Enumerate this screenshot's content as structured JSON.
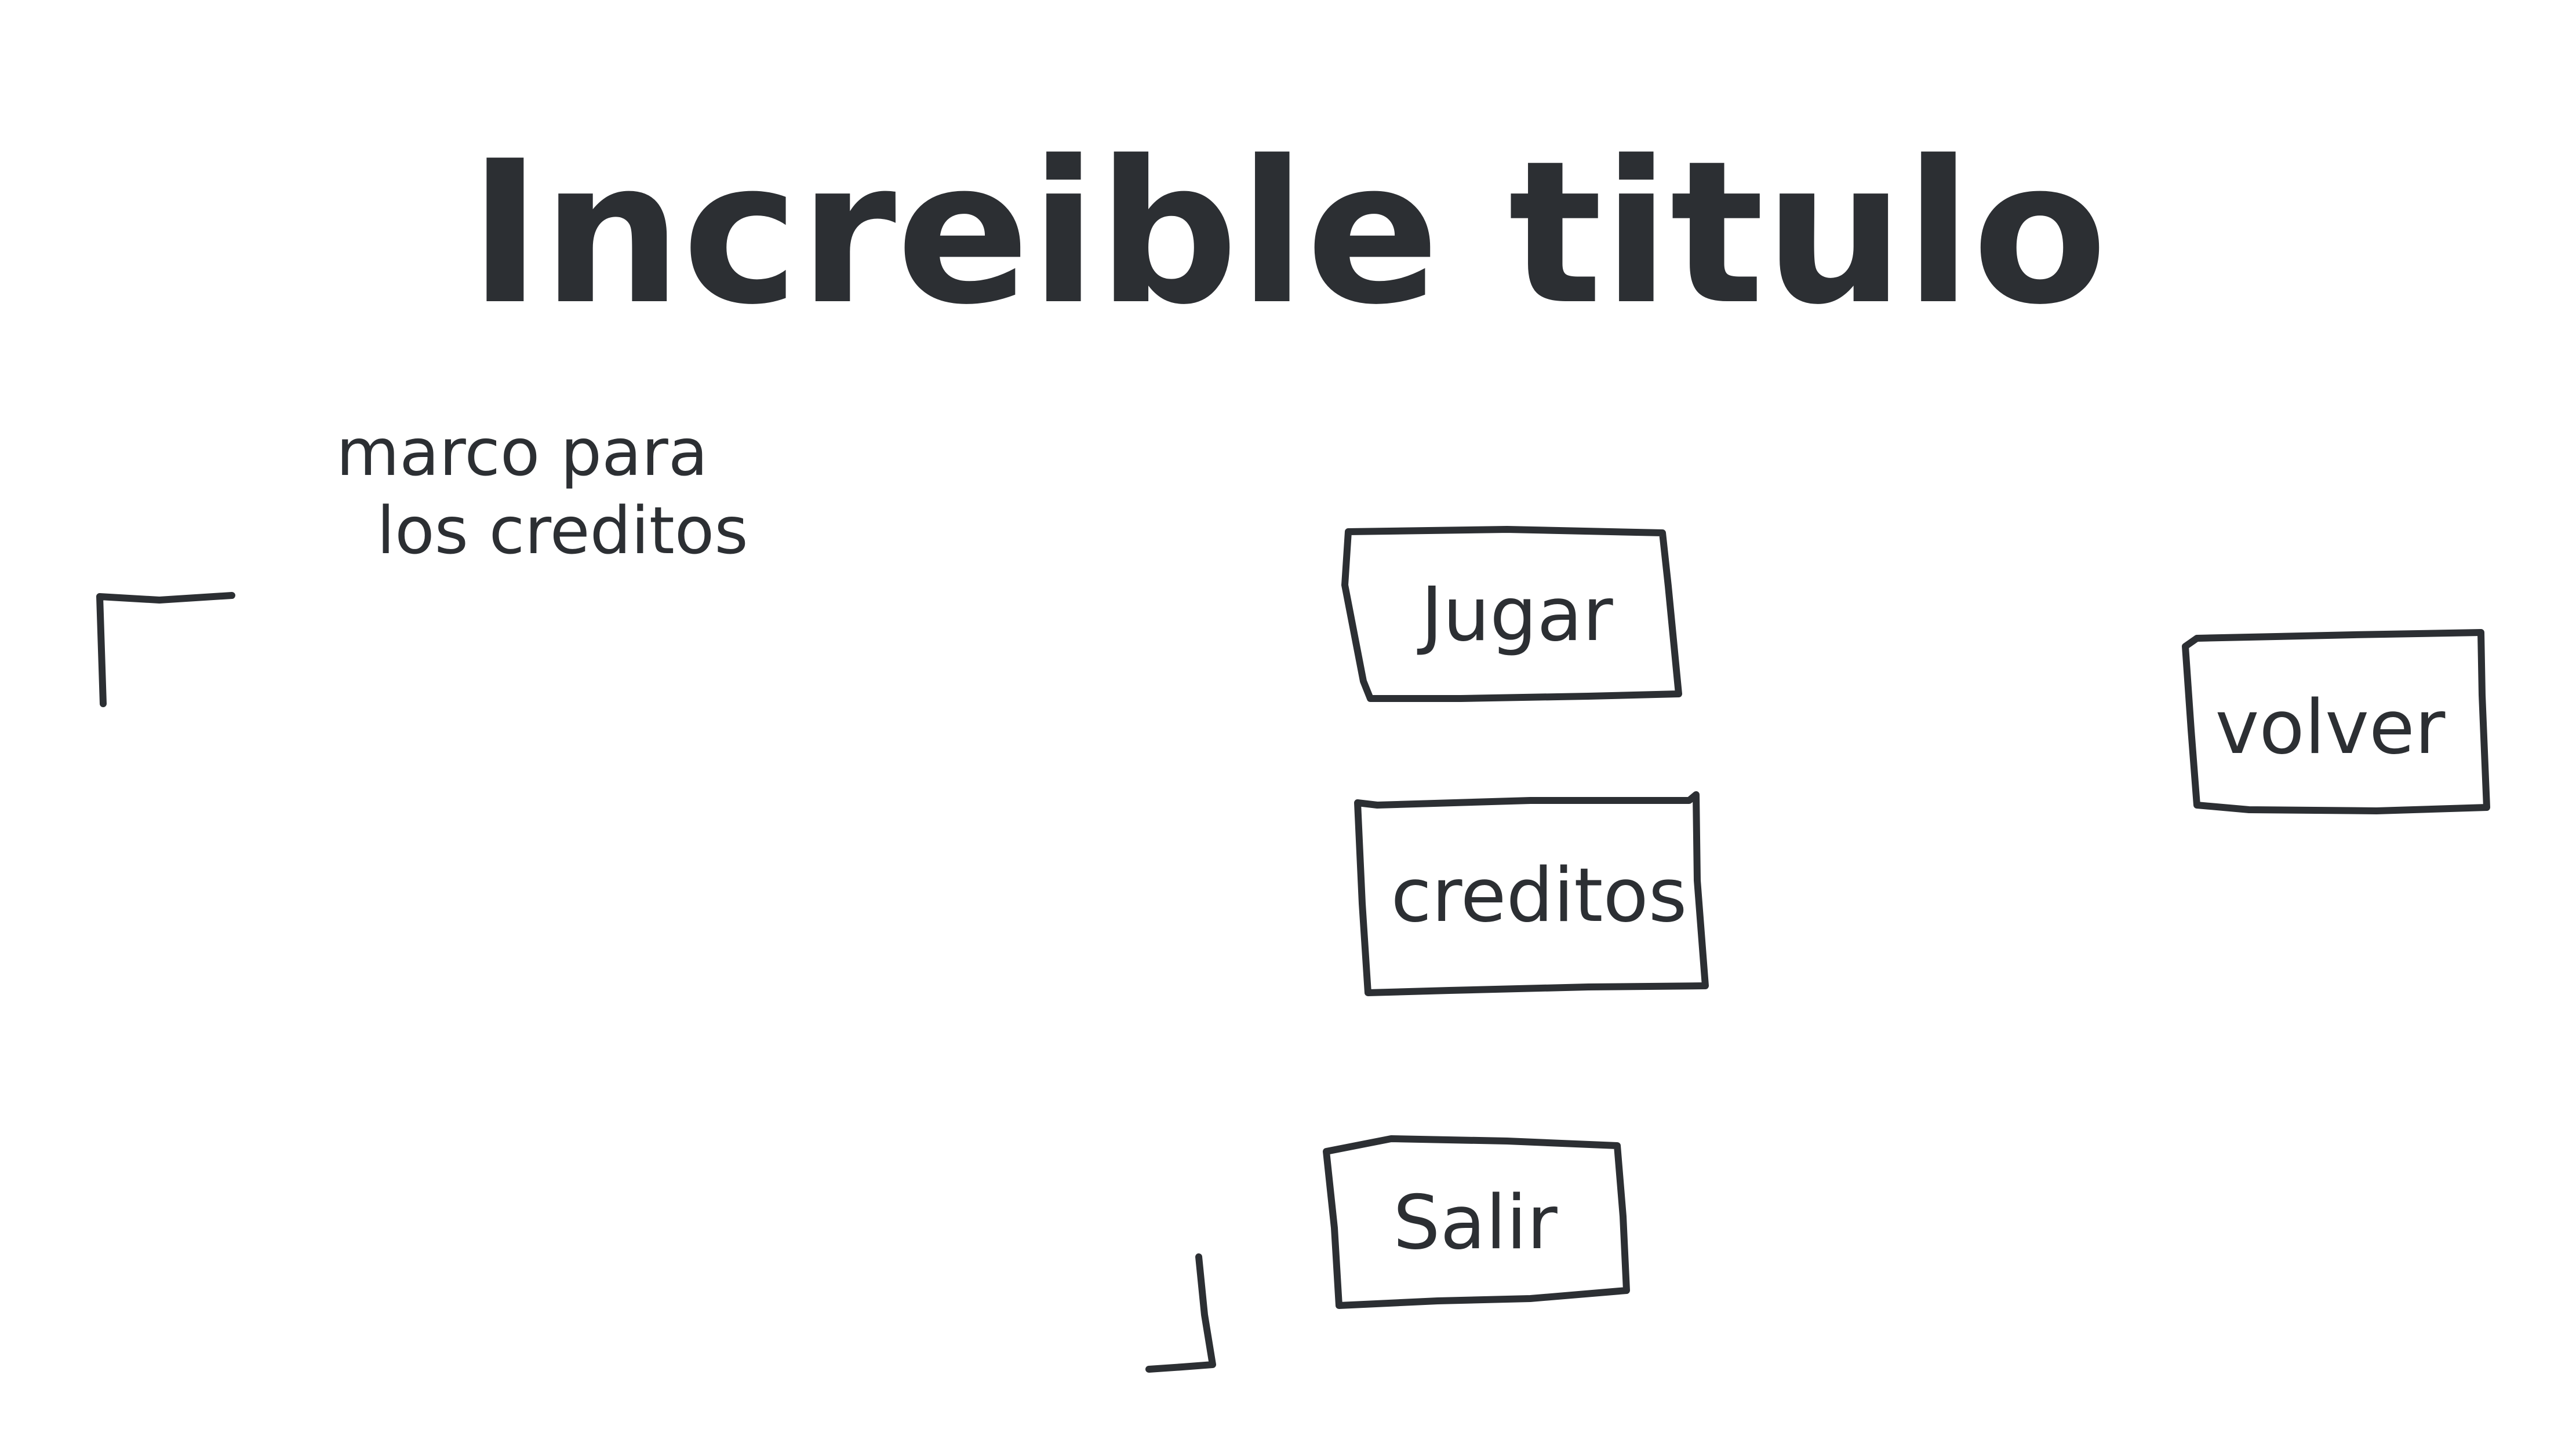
{
  "title": "Increible titulo",
  "credits_note": {
    "line1": "marco para",
    "line2": "los creditos"
  },
  "buttons": {
    "play": "Jugar",
    "credits": "creditos",
    "exit": "Salir",
    "back": "volver"
  },
  "ink_color": "#2c2f33",
  "background_color": "#ffffff"
}
